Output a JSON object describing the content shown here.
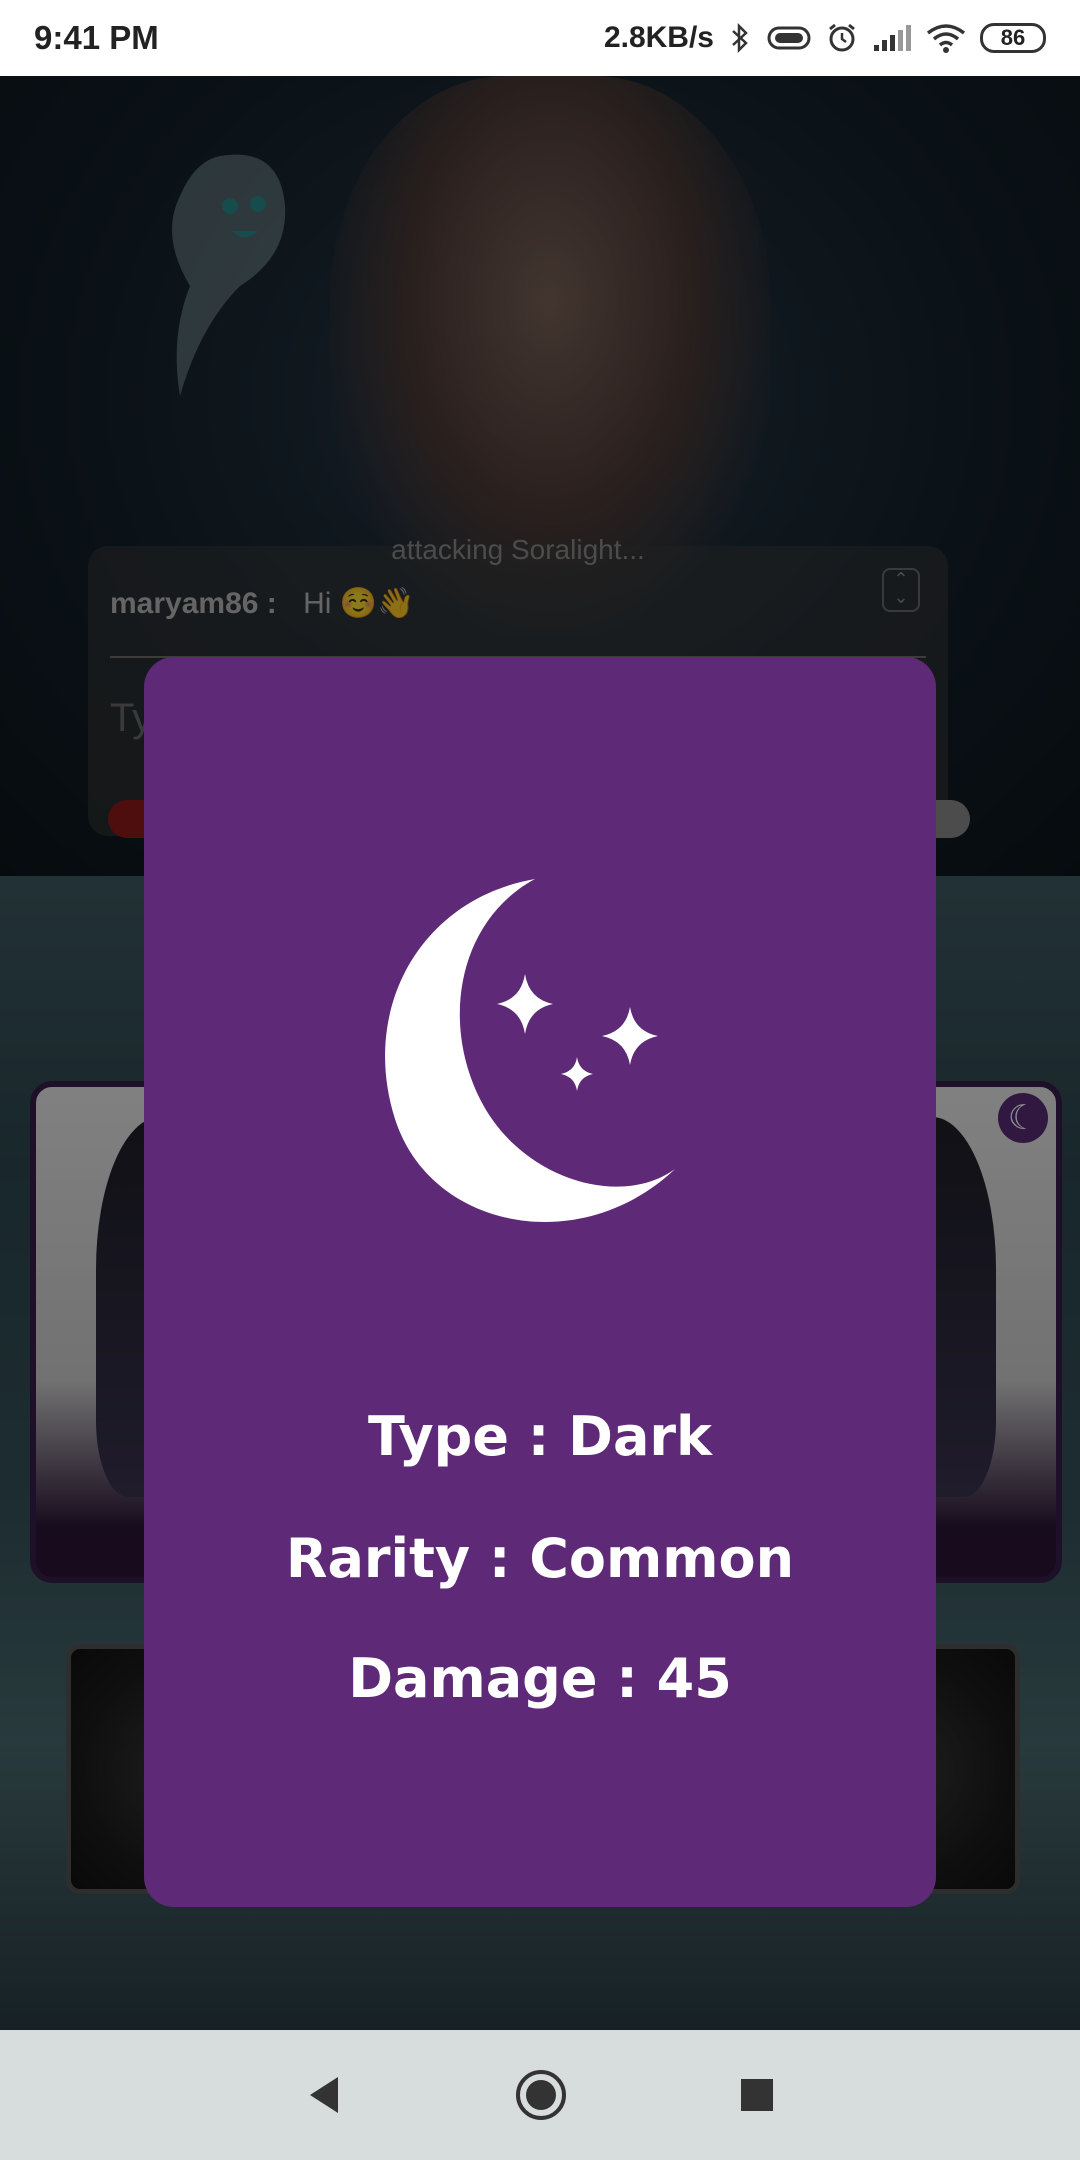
{
  "status_bar": {
    "time": "9:41 PM",
    "network_speed": "2.8KB/s",
    "battery_level": "86",
    "icons": [
      "bluetooth-icon",
      "vibrate-icon",
      "alarm-icon",
      "signal-icon",
      "wifi-icon",
      "battery-icon"
    ]
  },
  "chat": {
    "faded_message": "attacking Soralight...",
    "username": "maryam86 :",
    "message": "Hi ☺️👋",
    "input_placeholder": "Ty"
  },
  "card_dialog": {
    "icon": "moon-stars-icon",
    "type": "Type : Dark",
    "rarity": "Rarity : Common",
    "damage": "Damage : 45"
  },
  "colors": {
    "dialog_bg": "#5e2a77",
    "text": "#ffffff",
    "nav_bg": "#d7dcdd"
  },
  "nav": {
    "icons": [
      "back-icon",
      "home-icon",
      "recents-icon"
    ]
  }
}
